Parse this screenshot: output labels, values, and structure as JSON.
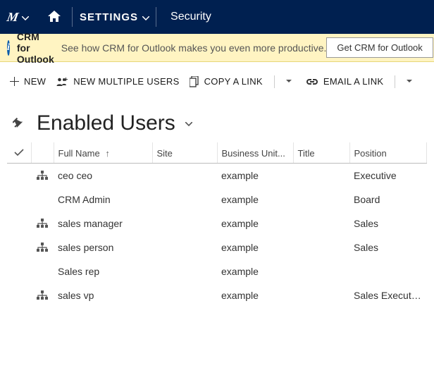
{
  "nav": {
    "settings_label": "SETTINGS",
    "breadcrumb": "Security"
  },
  "infobar": {
    "title": "CRM for Outlook",
    "text": "See how CRM for Outlook makes you even more productive.",
    "button_label": "Get CRM for Outlook"
  },
  "cmdbar": {
    "new": "NEW",
    "new_multiple": "NEW MULTIPLE USERS",
    "copy_link": "COPY A LINK",
    "email_link": "EMAIL A LINK"
  },
  "page": {
    "title": "Enabled Users"
  },
  "columns": {
    "full_name": "Full Name",
    "site": "Site",
    "business_unit": "Business Unit...",
    "title": "Title",
    "position": "Position"
  },
  "rows": [
    {
      "has_icon": true,
      "full_name": "ceo ceo",
      "site": "",
      "business_unit": "example",
      "title": "",
      "position": "Executive"
    },
    {
      "has_icon": false,
      "full_name": "CRM Admin",
      "site": "",
      "business_unit": "example",
      "title": "",
      "position": "Board"
    },
    {
      "has_icon": true,
      "full_name": "sales manager",
      "site": "",
      "business_unit": "example",
      "title": "",
      "position": "Sales"
    },
    {
      "has_icon": true,
      "full_name": "sales person",
      "site": "",
      "business_unit": "example",
      "title": "",
      "position": "Sales"
    },
    {
      "has_icon": false,
      "full_name": "Sales rep",
      "site": "",
      "business_unit": "example",
      "title": "",
      "position": ""
    },
    {
      "has_icon": true,
      "full_name": "sales vp",
      "site": "",
      "business_unit": "example",
      "title": "",
      "position": "Sales Executives"
    }
  ]
}
